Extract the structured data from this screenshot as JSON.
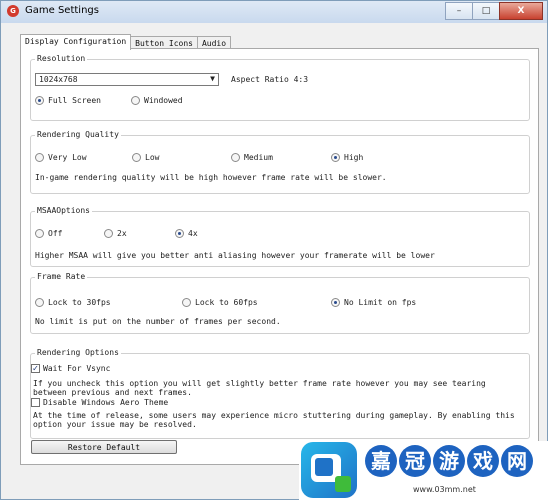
{
  "window": {
    "title": "Game Settings",
    "icon": "app-icon",
    "controls": {
      "minimize": "–",
      "maximize": "□",
      "close": "X"
    }
  },
  "tabs": [
    "Display Configuration",
    "Button Icons",
    "Audio"
  ],
  "resolution": {
    "label": "Resolution",
    "selected": "1024x768",
    "aspect": "Aspect Ratio 4:3",
    "modes": [
      {
        "label": "Full Screen",
        "checked": true
      },
      {
        "label": "Windowed",
        "checked": false
      }
    ]
  },
  "rendering_quality": {
    "label": "Rendering Quality",
    "options": [
      {
        "label": "Very Low",
        "checked": false
      },
      {
        "label": "Low",
        "checked": false
      },
      {
        "label": "Medium",
        "checked": false
      },
      {
        "label": "High",
        "checked": true
      }
    ],
    "description": "In-game rendering quality will be high however frame rate will be slower."
  },
  "msaa": {
    "label": "MSAAOptions",
    "options": [
      {
        "label": "Off",
        "checked": false
      },
      {
        "label": "2x",
        "checked": false
      },
      {
        "label": "4x",
        "checked": true
      }
    ],
    "description": "Higher MSAA will give you better anti aliasing however your framerate will be lower"
  },
  "frame_rate": {
    "label": "Frame Rate",
    "options": [
      {
        "label": "Lock  to 30fps",
        "checked": false
      },
      {
        "label": "Lock to 60fps",
        "checked": false
      },
      {
        "label": "No Limit on fps",
        "checked": true
      }
    ],
    "description": "No limit is put on the number of frames per second."
  },
  "rendering_options": {
    "label": "Rendering Options",
    "vsync": {
      "label": "Wait For Vsync",
      "checked": true
    },
    "vsync_desc": "If you uncheck this option you will get slightly better frame rate however you may see tearing between previous and next frames.",
    "aero": {
      "label": "Disable Windows Aero Theme",
      "checked": false
    },
    "aero_desc": "At the time of release, some users may experience micro stuttering during gameplay. By enabling this option your issue may be resolved."
  },
  "restore_button": "Restore Default",
  "watermark": {
    "chars": [
      "嘉",
      "冠",
      "游",
      "戏",
      "网"
    ],
    "url": "www.03mm.net"
  }
}
